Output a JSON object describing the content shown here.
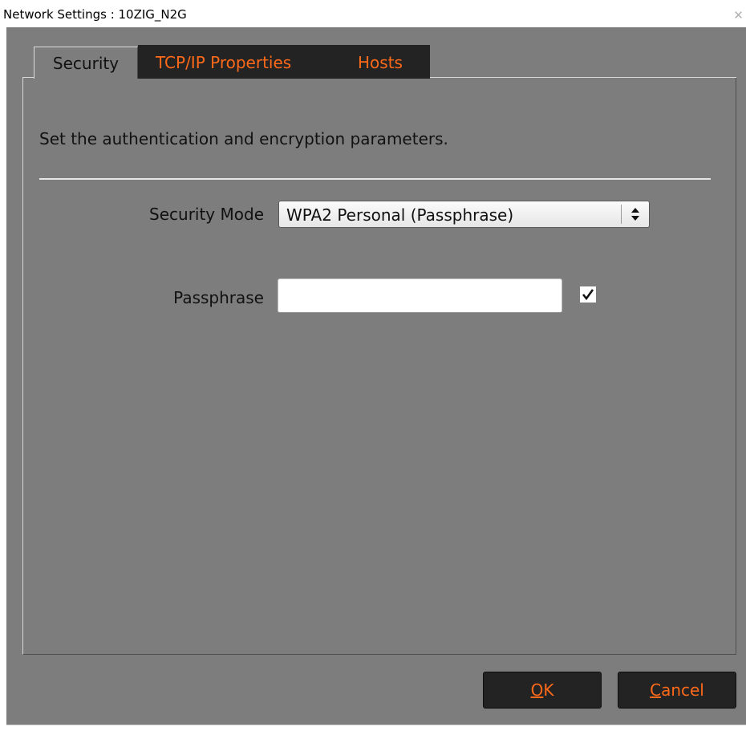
{
  "window": {
    "title": "Network Settings : 10ZIG_N2G"
  },
  "tabs": [
    {
      "label": "Security",
      "active": true
    },
    {
      "label": "TCP/IP Properties",
      "active": false
    },
    {
      "label": "Hosts",
      "active": false
    }
  ],
  "security": {
    "description": "Set the authentication and encryption parameters.",
    "mode_label": "Security Mode",
    "mode_value": "WPA2 Personal (Passphrase)",
    "passphrase_label": "Passphrase",
    "passphrase_value": "",
    "show_passphrase_checked": true
  },
  "buttons": {
    "ok_first": "O",
    "ok_rest": "K",
    "cancel_first": "C",
    "cancel_rest": "ancel"
  },
  "colors": {
    "dialog_bg": "#7d7d7d",
    "tab_bg": "#232323",
    "accent": "#ff6a1a"
  },
  "icons": {
    "close": "close-icon",
    "select_arrows": "updown-arrows-icon",
    "checkmark": "checkmark-icon"
  }
}
